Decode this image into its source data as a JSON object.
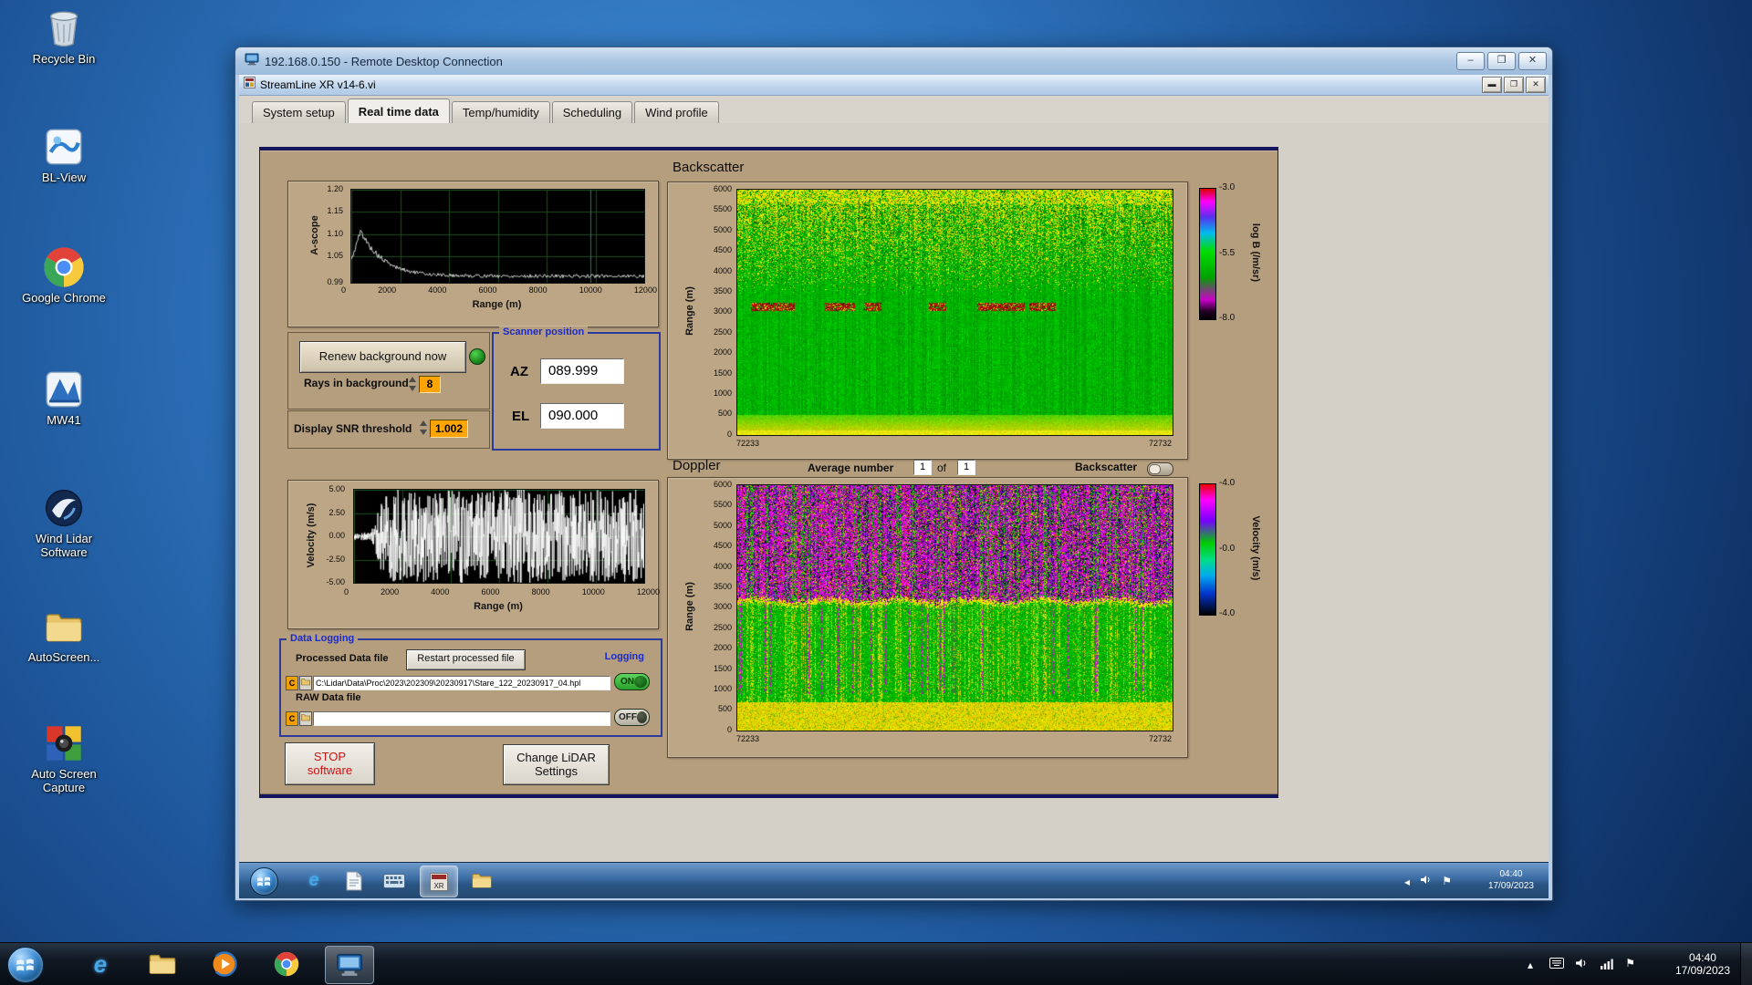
{
  "desktop": {
    "icons": [
      {
        "label": "Recycle Bin"
      },
      {
        "label": "BL-View"
      },
      {
        "label": "Google Chrome"
      },
      {
        "label": "MW41"
      },
      {
        "label": "Wind Lidar Software"
      },
      {
        "label": "AutoScreen..."
      },
      {
        "label": "Auto Screen Capture"
      }
    ]
  },
  "rdp_window": {
    "title": "192.168.0.150 - Remote Desktop Connection"
  },
  "app_window": {
    "title": "StreamLine XR v14-6.vi",
    "tabs": [
      {
        "label": "System setup"
      },
      {
        "label": "Real time data"
      },
      {
        "label": "Temp/humidity"
      },
      {
        "label": "Scheduling"
      },
      {
        "label": "Wind profile"
      }
    ]
  },
  "controls": {
    "renew_button": "Renew background now",
    "rays_label": "Rays in background",
    "rays_value": "8",
    "snr_label": "Display SNR threshold",
    "snr_value": "1.002",
    "scanner": {
      "title": "Scanner position",
      "az_label": "AZ",
      "az_value": "089.999",
      "el_label": "EL",
      "el_value": "090.000"
    },
    "average_label": "Average number",
    "average_value": "1",
    "average_of": "of",
    "average_value2": "1",
    "backscatter_toggle_label": "Backscatter",
    "data_logging": {
      "title": "Data Logging",
      "processed_label": "Processed Data file",
      "restart_button": "Restart processed file",
      "logging_label": "Logging",
      "drive_letter": "C",
      "processed_path": "C:\\Lidar\\Data\\Proc\\2023\\202309\\20230917\\Stare_122_20230917_04.hpl",
      "on_label": "ON",
      "off_label": "OFF",
      "raw_label": "RAW Data file",
      "raw_path": ""
    },
    "stop_line1": "STOP",
    "stop_line2": "software",
    "change_line1": "Change LiDAR",
    "change_line2": "Settings"
  },
  "remote_taskbar": {
    "time": "04:40",
    "date": "17/09/2023"
  },
  "host_taskbar": {
    "time": "04:40",
    "date": "17/09/2023"
  },
  "chart_data": [
    {
      "id": "ascope",
      "type": "line",
      "ylabel": "A-scope",
      "xlabel": "Range (m)",
      "yticks": [
        "1.20",
        "1.15",
        "1.10",
        "1.05",
        "0.99"
      ],
      "xticks": [
        "0",
        "2000",
        "4000",
        "6000",
        "8000",
        "10000",
        "12000"
      ],
      "ylim": [
        0.99,
        1.2
      ],
      "xlim": [
        0,
        12000
      ],
      "line_color": "#ffffff",
      "bg": "#000000",
      "grid_color": "#1d4d1d",
      "signal": {
        "baseline": 1.005,
        "peak": 1.105,
        "peak_x": 400,
        "decay": 900,
        "noise": 0.004,
        "cursor_x": 9800
      }
    },
    {
      "id": "velocity",
      "type": "line",
      "ylabel": "Velocity (m/s)",
      "xlabel": "Range (m)",
      "yticks": [
        "5.00",
        "2.50",
        "0.00",
        "-2.50",
        "-5.00"
      ],
      "xticks": [
        "0",
        "2000",
        "4000",
        "6000",
        "8000",
        "10000",
        "12000"
      ],
      "ylim": [
        -5,
        5
      ],
      "xlim": [
        0,
        12000
      ],
      "line_color": "#ffffff",
      "bg": "#000000",
      "grid_color": "#1d4d1d",
      "signal": {
        "calm_until": 700,
        "calm_amp": 0.45,
        "amp": 5
      }
    },
    {
      "id": "backscatter",
      "type": "heatmap",
      "title": "Backscatter",
      "ylabel": "Range (m)",
      "yticks": [
        "6000",
        "5500",
        "5000",
        "4500",
        "4000",
        "3500",
        "3000",
        "2500",
        "2000",
        "1500",
        "1000",
        "500",
        "0"
      ],
      "xticks": [
        "72233",
        "72732"
      ],
      "ylim": [
        0,
        6000
      ],
      "colorbar": {
        "label": "log B (/m/sr)",
        "ticks": [
          "-3.0",
          "-5.5",
          "-8.0"
        ],
        "stops": [
          [
            "0%",
            "#dd0000"
          ],
          [
            "10%",
            "#ff00ff"
          ],
          [
            "22%",
            "#5533ee"
          ],
          [
            "34%",
            "#00bbee"
          ],
          [
            "48%",
            "#00dd00"
          ],
          [
            "68%",
            "#00a000"
          ],
          [
            "85%",
            "#cc00cc"
          ],
          [
            "94%",
            "#220022"
          ],
          [
            "100%",
            "#000000"
          ]
        ]
      },
      "features": {
        "ymax": 6000,
        "noise_top_start": 3400,
        "aerosol_layer": [
          3040,
          3240
        ],
        "aerosol_segments": [
          [
            0.03,
            0.13
          ],
          [
            0.2,
            0.27
          ],
          [
            0.29,
            0.33
          ],
          [
            0.44,
            0.48
          ],
          [
            0.55,
            0.66
          ],
          [
            0.67,
            0.73
          ]
        ],
        "surface_band": 350
      }
    },
    {
      "id": "doppler",
      "type": "heatmap",
      "title": "Doppler",
      "ylabel": "Range (m)",
      "yticks": [
        "6000",
        "5500",
        "5000",
        "4500",
        "4000",
        "3500",
        "3000",
        "2500",
        "2000",
        "1500",
        "1000",
        "500",
        "0"
      ],
      "xticks": [
        "72233",
        "72732"
      ],
      "ylim": [
        0,
        6000
      ],
      "colorbar": {
        "label": "Velocity (m/s)",
        "ticks": [
          "-4.0",
          "-0.0",
          "-4.0"
        ],
        "stops": [
          [
            "0%",
            "#ee0000"
          ],
          [
            "12%",
            "#ff00ff"
          ],
          [
            "28%",
            "#7700ff"
          ],
          [
            "45%",
            "#00cc00"
          ],
          [
            "58%",
            "#00dd88"
          ],
          [
            "70%",
            "#00aaee"
          ],
          [
            "84%",
            "#0033cc"
          ],
          [
            "100%",
            "#000000"
          ]
        ]
      },
      "features": {
        "ymax": 6000,
        "boundary": 3150
      }
    }
  ]
}
